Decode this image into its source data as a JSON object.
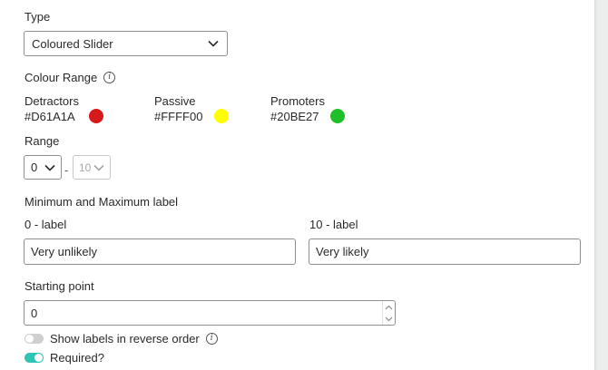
{
  "type_section": {
    "label": "Type",
    "selected": "Coloured Slider"
  },
  "colour_range": {
    "label": "Colour Range",
    "items": [
      {
        "name": "Detractors",
        "hex": "#D61A1A",
        "color": "#D61A1A"
      },
      {
        "name": "Passive",
        "hex": "#FFFF00",
        "color": "#FFFF00"
      },
      {
        "name": "Promoters",
        "hex": "#20BE27",
        "color": "#20BE27"
      }
    ]
  },
  "range": {
    "label": "Range",
    "min": "0",
    "separator": "-",
    "max": "10"
  },
  "min_max_labels": {
    "label": "Minimum and Maximum label",
    "min_label_title": "0 - label",
    "min_label_value": "Very unlikely",
    "max_label_title": "10 - label",
    "max_label_value": "Very likely"
  },
  "starting_point": {
    "label": "Starting point",
    "value": "0"
  },
  "toggles": {
    "reverse": {
      "label": "Show labels in reverse order",
      "on": false
    },
    "required": {
      "label": "Required?",
      "on": true
    }
  },
  "accent_color": "#2ec4b6"
}
